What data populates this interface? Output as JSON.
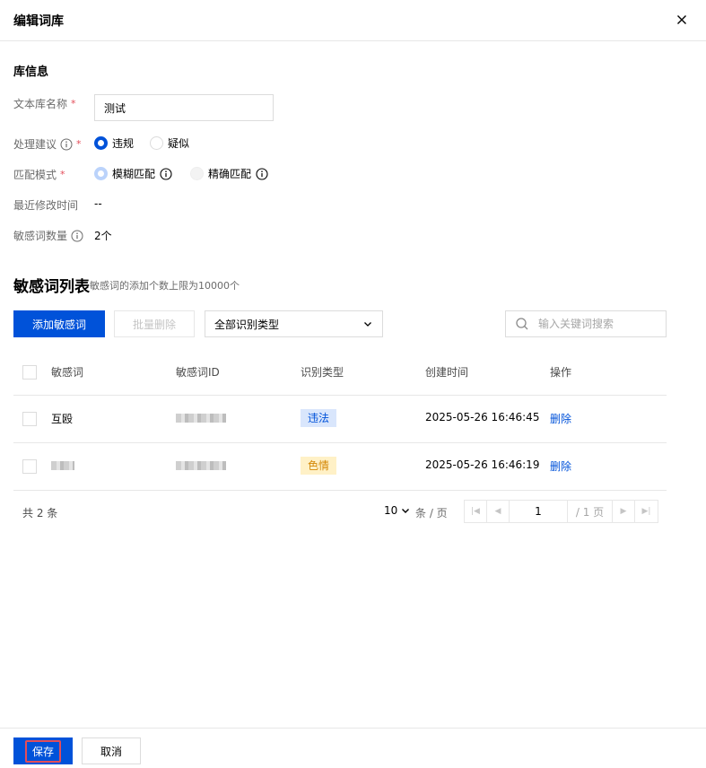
{
  "dialog": {
    "title": "编辑词库"
  },
  "info": {
    "section_title": "库信息",
    "name_label": "文本库名称",
    "name_value": "测试",
    "required_mark": "*",
    "suggestion_label": "处理建议",
    "suggestion_options": [
      "违规",
      "疑似"
    ],
    "match_label": "匹配模式",
    "match_options": [
      "模糊匹配",
      "精确匹配"
    ],
    "modified_label": "最近修改时间",
    "modified_value": "--",
    "count_label": "敏感词数量",
    "count_value": "2个"
  },
  "list": {
    "title": "敏感词列表",
    "subtitle": "敏感词的添加个数上限为10000个",
    "add_button": "添加敏感词",
    "batch_delete_button": "批量删除",
    "type_filter": "全部识别类型",
    "search_placeholder": "输入关键词搜索",
    "columns": [
      "敏感词",
      "敏感词ID",
      "识别类型",
      "创建时间",
      "操作"
    ],
    "rows": [
      {
        "word": "互殴",
        "tag": "违法",
        "created": "2025-05-26 16:46:45",
        "action": "删除"
      },
      {
        "word": "",
        "tag": "色情",
        "created": "2025-05-26 16:46:19",
        "action": "删除"
      }
    ],
    "colors": {
      "primary": "#0052d9",
      "tag_blue_bg": "#d9e6fc",
      "tag_yellow_bg": "#fff1c7",
      "tag_yellow_text": "#d48806"
    }
  },
  "pagination": {
    "total": "共 2 条",
    "page_size": "10",
    "page_unit": "条 / 页",
    "current_page": "1",
    "total_pages": "/ 1 页"
  },
  "footer": {
    "save": "保存",
    "cancel": "取消"
  }
}
